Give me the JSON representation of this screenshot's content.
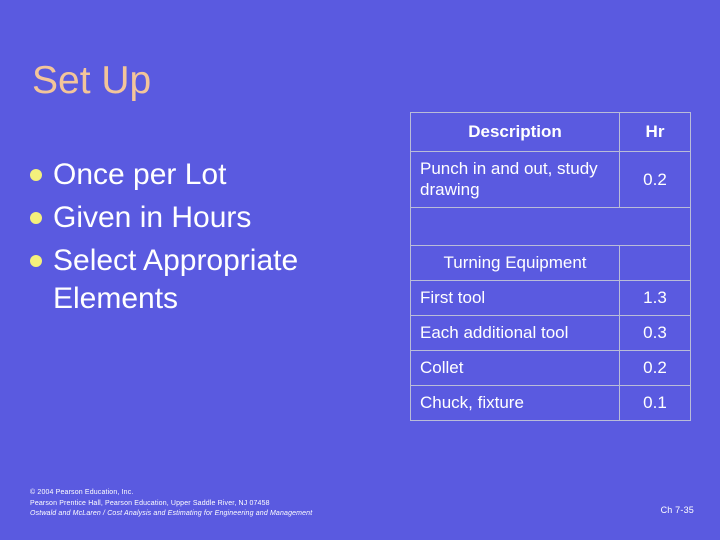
{
  "slide": {
    "title": "Set Up",
    "background_color": "#5a5ae0",
    "title_color": "#f3c59a",
    "text_color": "#ffffff",
    "bullet_color": "#f4f07c",
    "table_border_color": "#b9bcd8"
  },
  "body": {
    "bullets": [
      {
        "marker": "bullet-dot",
        "text": "Once per Lot"
      },
      {
        "marker": "bullet-dot",
        "text": "Given in Hours"
      },
      {
        "marker": "bullet-dot",
        "text": "Select Appropriate Elements"
      }
    ]
  },
  "table": {
    "headers": [
      "Description",
      "Hr"
    ],
    "rows": [
      {
        "kind": "data",
        "description": "Punch in and out, study drawing",
        "hr": "0.2"
      },
      {
        "kind": "spacer",
        "description": "",
        "hr": ""
      },
      {
        "kind": "section",
        "description": "Turning Equipment",
        "hr": ""
      },
      {
        "kind": "data",
        "description": "First tool",
        "hr": "1.3"
      },
      {
        "kind": "data",
        "description": "Each additional tool",
        "hr": "0.3"
      },
      {
        "kind": "data",
        "description": "Collet",
        "hr": "0.2"
      },
      {
        "kind": "data",
        "description": "Chuck, fixture",
        "hr": "0.1"
      }
    ]
  },
  "footer": {
    "line1": "© 2004 Pearson Education, Inc.",
    "line2": "Pearson Prentice Hall, Pearson Education, Upper Saddle River, NJ 07458",
    "line3": "Ostwald and McLaren / Cost Analysis and Estimating for Engineering and Management",
    "page": "Ch 7-35"
  }
}
